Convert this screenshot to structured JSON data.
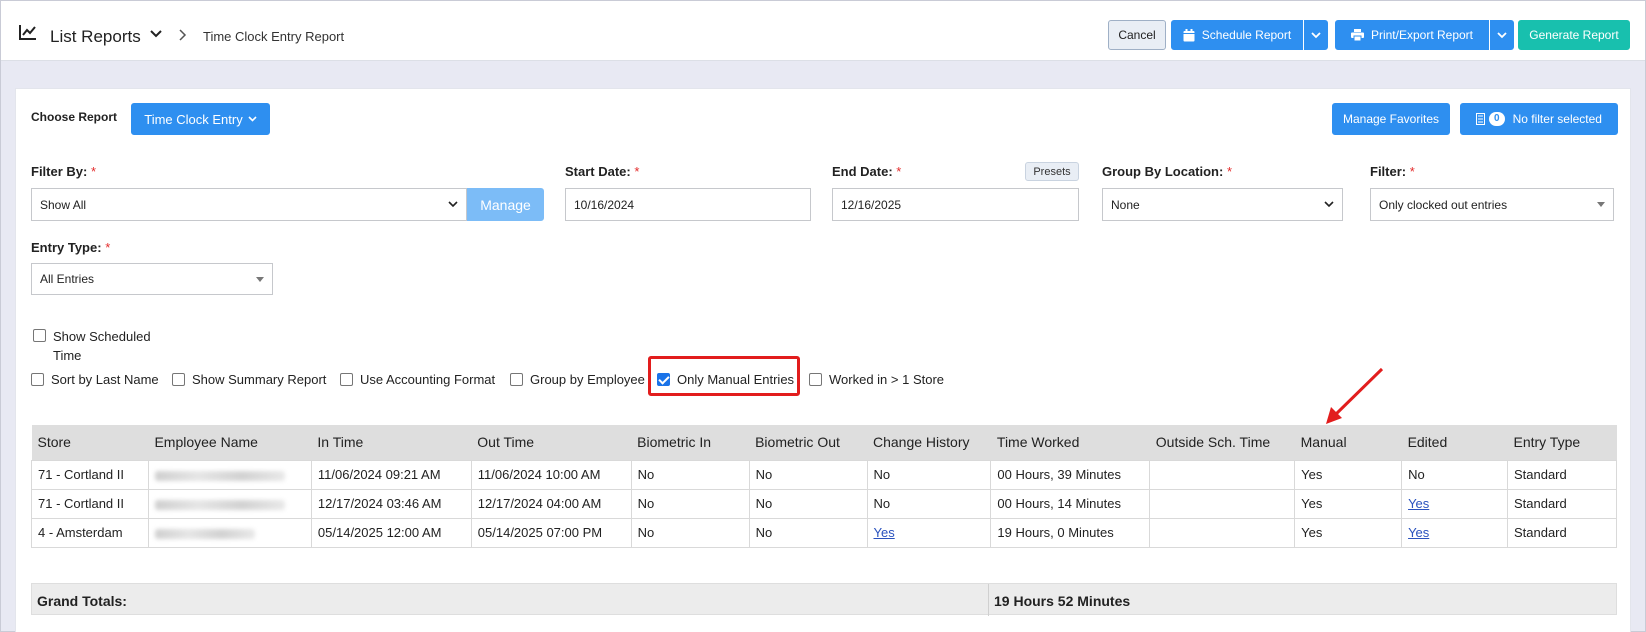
{
  "header": {
    "title": "List Reports",
    "breadcrumb": "Time Clock Entry Report",
    "cancel_label": "Cancel",
    "schedule_label": "Schedule Report",
    "print_label": "Print/Export Report",
    "generate_label": "Generate Report"
  },
  "toolbar": {
    "choose_label": "Choose Report",
    "report_type": "Time Clock Entry",
    "manage_favorites": "Manage Favorites",
    "filter_count": "0",
    "filter_label": "No filter selected"
  },
  "filters": {
    "filter_by_label": "Filter By:",
    "filter_by_value": "Show All",
    "manage_label": "Manage",
    "start_label": "Start Date:",
    "start_value": "10/16/2024",
    "end_label": "End Date:",
    "end_value": "12/16/2025",
    "presets_label": "Presets",
    "group_label": "Group By Location:",
    "group_value": "None",
    "filter_label": "Filter:",
    "filter_value": "Only clocked out entries",
    "entry_type_label": "Entry Type:",
    "entry_type_value": "All Entries",
    "required_mark": "*"
  },
  "options": {
    "show_scheduled": "Show Scheduled",
    "show_scheduled_2": "Time",
    "sort_last": "Sort by Last Name",
    "summary": "Show Summary Report",
    "accounting": "Use Accounting Format",
    "group_employee": "Group by Employee",
    "only_manual": "Only Manual Entries",
    "worked_more": "Worked in > 1 Store"
  },
  "table": {
    "headers": [
      "Store",
      "Employee Name",
      "In Time",
      "Out Time",
      "Biometric In",
      "Biometric Out",
      "Change History",
      "Time Worked",
      "Outside Sch. Time",
      "Manual",
      "Edited",
      "Entry Type"
    ],
    "rows": [
      {
        "store": "71 - Cortland II",
        "in": "11/06/2024 09:21 AM",
        "out": "11/06/2024 10:00 AM",
        "bio_in": "No",
        "bio_out": "No",
        "history": "No",
        "worked": "00 Hours, 39 Minutes",
        "outside": "",
        "manual": "Yes",
        "edited": "No",
        "type": "Standard"
      },
      {
        "store": "71 - Cortland II",
        "in": "12/17/2024 03:46 AM",
        "out": "12/17/2024 04:00 AM",
        "bio_in": "No",
        "bio_out": "No",
        "history": "No",
        "worked": "00 Hours, 14 Minutes",
        "outside": "",
        "manual": "Yes",
        "edited": "Yes",
        "type": "Standard"
      },
      {
        "store": "4 - Amsterdam",
        "in": "05/14/2025 12:00 AM",
        "out": "05/14/2025 07:00 PM",
        "bio_in": "No",
        "bio_out": "No",
        "history": "Yes",
        "worked": "19 Hours, 0 Minutes",
        "outside": "",
        "manual": "Yes",
        "edited": "Yes",
        "type": "Standard"
      }
    ]
  },
  "totals": {
    "label": "Grand Totals:",
    "value": "19 Hours 52 Minutes"
  },
  "colors": {
    "primary": "#2e8ff0",
    "generate": "#18c0ae",
    "highlight": "#e21d1d"
  }
}
